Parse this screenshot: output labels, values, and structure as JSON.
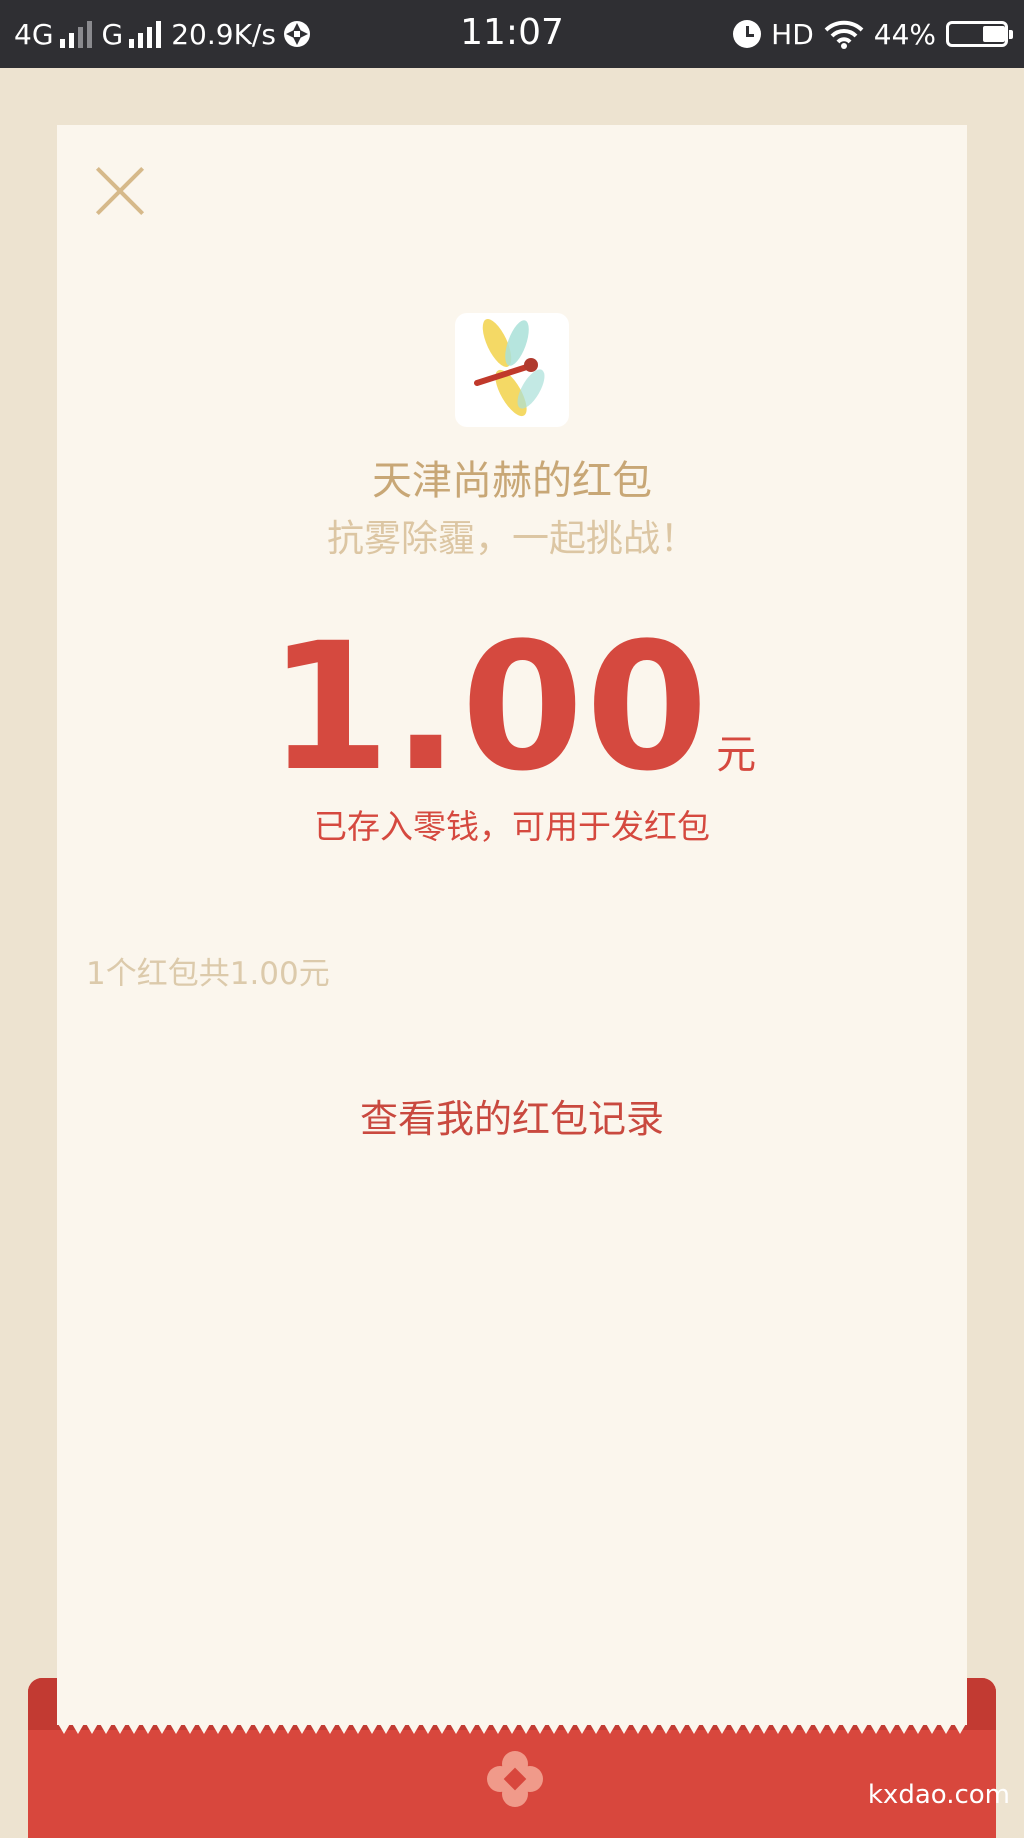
{
  "status_bar": {
    "network1": "4G",
    "network2": "G",
    "speed": "20.9K/s",
    "time": "11:07",
    "hd": "HD",
    "battery": "44%",
    "battery_level_percent": 44
  },
  "packet": {
    "sender": "天津尚赫的红包",
    "wish": "抗雾除霾，一起挑战！",
    "amount": "1.00",
    "unit": "元",
    "deposit_note": "已存入零钱，可用于发红包",
    "summary": "1个红包共1.00元",
    "history_link": "查看我的红包记录"
  },
  "watermark": "kxdao.com",
  "icons": {
    "close": "close-icon",
    "avatar": "dragonfly-icon",
    "envelope": "flower-logo-icon"
  },
  "colors": {
    "accent_red": "#d5493f",
    "gold": "#c8a776",
    "paper": "#fbf6ed"
  }
}
